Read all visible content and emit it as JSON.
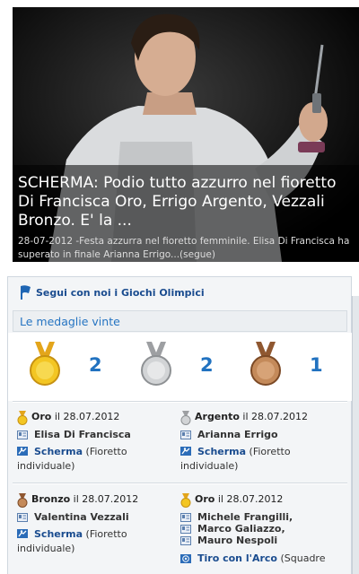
{
  "hero": {
    "title_line1": "SCHERMA: Podio tutto azzurro nel fioretto",
    "title_line2": "Di Francisca Oro, Errigo Argento, Vezzali",
    "title_line3": "Bronzo. E' la ...",
    "desc_line1": "28-07-2012 -Festa azzurra nel fioretto femminile. Elisa Di Francisca ha",
    "desc_line2": "superato in finale Arianna Errigo...(segue)"
  },
  "module": {
    "follow_link": "Segui con noi i Giochi Olimpici",
    "medals_title": "Le medaglie vinte",
    "summary": {
      "gold": "2",
      "silver": "2",
      "bronze": "1"
    }
  },
  "entries": [
    {
      "medal": "Oro",
      "date": "il 28.07.2012",
      "athletes": [
        "Elisa Di Francisca"
      ],
      "sport": "Scherma",
      "event_a": "(Fioretto",
      "event_b": "individuale)"
    },
    {
      "medal": "Argento",
      "date": "il 28.07.2012",
      "athletes": [
        "Arianna Errigo"
      ],
      "sport": "Scherma",
      "event_a": "(Fioretto",
      "event_b": "individuale)"
    },
    {
      "medal": "Bronzo",
      "date": "il 28.07.2012",
      "athletes": [
        "Valentina Vezzali"
      ],
      "sport": "Scherma",
      "event_a": "(Fioretto",
      "event_b": "individuale)"
    },
    {
      "medal": "Oro",
      "date": "il 28.07.2012",
      "athletes": [
        "Michele Frangilli,",
        "Marco Galiazzo,",
        "Mauro Nespoli"
      ],
      "sport": "Tiro con l'Arco",
      "event_a": "(Squadre"
    }
  ],
  "colors": {
    "link": "#1a4c8f",
    "accent": "#2574c2",
    "gold": "#e9b81f",
    "silver": "#b8b8b8",
    "bronze": "#a96a3a"
  }
}
